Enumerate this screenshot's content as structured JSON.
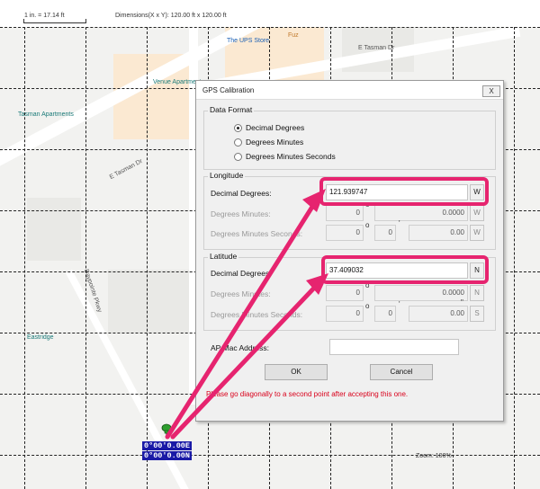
{
  "map": {
    "scale": "1 in. = 17.14 ft",
    "dimensions": "Dimensions(X x Y): 120.00 ft x 120.00 ft",
    "zoom": "Zoom: 100%",
    "coord_east": "0°00'0.00E",
    "coord_north": "0°00'0.00N",
    "labels": {
      "ups": "The UPS Store",
      "tasman1": "E Tasman Dr",
      "tasman2": "E Tasman Dr",
      "venue": "Venue Apartment",
      "tasman_apts": "Tasman Apartments",
      "baypointe": "Baypointe Pkwy",
      "eastridge": "Eastridge",
      "cafe": "Fuz"
    }
  },
  "dialog": {
    "title": "GPS Calibration",
    "close": "X",
    "data_format": {
      "label": "Data Format",
      "options": [
        "Decimal Degrees",
        "Degrees Minutes",
        "Degrees Minutes Seconds"
      ],
      "selected": 0
    },
    "longitude": {
      "label": "Longitude",
      "decimal_label": "Decimal Degrees:",
      "decimal_value": "121.939747",
      "decimal_hemi": "W",
      "dm_label": "Degrees Minutes:",
      "dm_deg": "0",
      "dm_min": "0.0000",
      "dm_hemi": "W",
      "dms_label": "Degrees Minutes Seconds:",
      "dms_deg": "0",
      "dms_min": "0",
      "dms_sec": "0.00",
      "dms_hemi": "W"
    },
    "latitude": {
      "label": "Latitude",
      "decimal_label": "Decimal Degrees:",
      "decimal_value": "37.409032",
      "decimal_hemi": "N",
      "dm_label": "Degrees Minutes:",
      "dm_deg": "0",
      "dm_min": "0.0000",
      "dm_hemi": "N",
      "dms_label": "Degrees Minutes Seconds:",
      "dms_deg": "0",
      "dms_min": "0",
      "dms_sec": "0.00",
      "dms_hemi": "S"
    },
    "symbols": {
      "deg": "o",
      "min": "'",
      "sec": "\""
    },
    "ap_mac_label": "AP Mac Address:",
    "ap_mac_value": "",
    "ok": "OK",
    "cancel": "Cancel",
    "message": "Please go diagonally to a second point after accepting this one."
  },
  "colors": {
    "highlight": "#e6246f",
    "coord_bg": "#1a1aa6",
    "message": "#d9001b"
  }
}
